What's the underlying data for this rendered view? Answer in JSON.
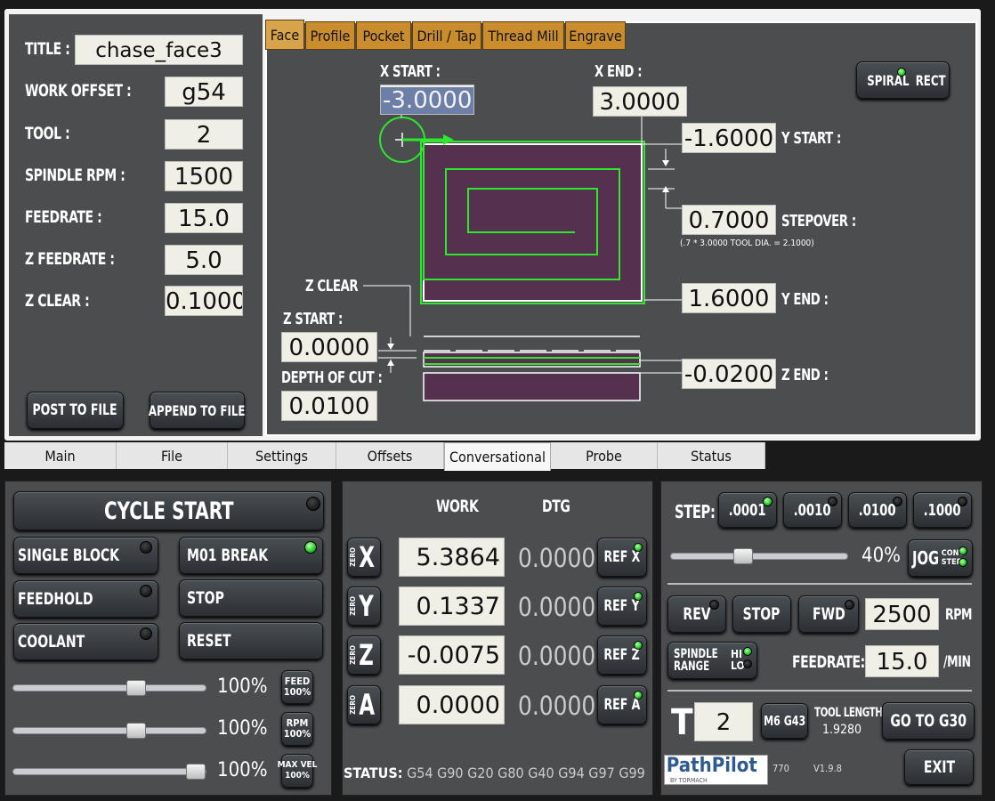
{
  "left_form": {
    "title_label": "TITLE :",
    "title_value": "chase_face3",
    "work_offset_label": "WORK OFFSET :",
    "work_offset_value": "g54",
    "tool_label": "TOOL :",
    "tool_value": "2",
    "spindle_label": "SPINDLE RPM :",
    "spindle_value": "1500",
    "feedrate_label": "FEEDRATE :",
    "feedrate_value": "15.0",
    "zfeed_label": "Z FEEDRATE :",
    "zfeed_value": "5.0",
    "zclear_label": "Z CLEAR :",
    "zclear_value": "0.1000",
    "post_button": "POST TO FILE",
    "append_button": "APPEND TO FILE"
  },
  "feature_tabs": [
    "Face",
    "Profile",
    "Pocket",
    "Drill / Tap",
    "Thread Mill",
    "Engrave"
  ],
  "face": {
    "x_start_label": "X START :",
    "x_start_value": "-3.0000",
    "x_end_label": "X END :",
    "x_end_value": "3.0000",
    "y_start_label": "Y START :",
    "y_start_value": "-1.6000",
    "stepover_label": "STEPOVER :",
    "stepover_value": "0.7000",
    "stepover_note": "(.7 * 3.0000 TOOL DIA. = 2.1000)",
    "y_end_label": "Y END :",
    "y_end_value": "1.6000",
    "z_clear_label": "Z CLEAR",
    "z_start_label": "Z START :",
    "z_start_value": "0.0000",
    "doc_label": "DEPTH OF CUT :",
    "doc_value": "0.0100",
    "z_end_label": "Z END :",
    "z_end_value": "-0.0200",
    "spiral_label": "SPIRAL",
    "rect_label": "RECT"
  },
  "main_tabs": [
    "Main",
    "File",
    "Settings",
    "Offsets",
    "Conversational",
    "Probe",
    "Status"
  ],
  "cycle": {
    "cycle_start": "CYCLE START",
    "single_block": "SINGLE BLOCK",
    "m01_break": "M01 BREAK",
    "feedhold": "FEEDHOLD",
    "stop": "STOP",
    "coolant": "COOLANT",
    "reset": "RESET",
    "feed_pct": "100%",
    "rpm_pct": "100%",
    "maxvel_pct": "100%",
    "feed_btn": [
      "FEED",
      "100%"
    ],
    "rpm_btn": [
      "RPM",
      "100%"
    ],
    "maxvel_btn": [
      "MAX VEL",
      "100%"
    ],
    "feed_override": 1.0,
    "rpm_override": 1.0,
    "maxvel_override": 1.0
  },
  "dro": {
    "work_header": "WORK",
    "dtg_header": "DTG",
    "zero_label": "ZERO",
    "axes": [
      {
        "axis": "X",
        "work": "5.3864",
        "dtg": "0.0000",
        "ref": "REF X"
      },
      {
        "axis": "Y",
        "work": "0.1337",
        "dtg": "0.0000",
        "ref": "REF Y"
      },
      {
        "axis": "Z",
        "work": "-0.0075",
        "dtg": "0.0000",
        "ref": "REF Z"
      },
      {
        "axis": "A",
        "work": "0.0000",
        "dtg": "0.0000",
        "ref": "REF A"
      }
    ],
    "status_label": "STATUS:",
    "status_codes": "G54 G90 G20 G80 G40 G94 G97 G99"
  },
  "jog": {
    "step_label": "STEP:",
    "steps": [
      ".0001",
      ".0010",
      ".0100",
      ".1000"
    ],
    "jog_pct": "40%",
    "jog_fraction": 0.4,
    "jog_button": "JOG",
    "cont_label": "CONT",
    "step_mode_label": "STEP",
    "rev": "REV",
    "stop": "STOP",
    "fwd": "FWD",
    "rpm_value": "2500",
    "rpm_unit": "RPM",
    "spindle_range": [
      "SPINDLE",
      "RANGE"
    ],
    "hi": "HI",
    "lo": "LO",
    "feedrate_label": "FEEDRATE:",
    "feedrate_value": "15.0",
    "feed_unit": "/MIN",
    "t_label": "T",
    "tool_value": "2",
    "m6g43": "M6 G43",
    "tool_length_label": "TOOL LENGTH",
    "tool_length_value": "1.9280",
    "goto_g30": "GO TO G30",
    "brand": "PathPilot",
    "brand_sub": "BY TORMACH",
    "model": "770",
    "version": "V1.9.8",
    "exit": "EXIT"
  },
  "colors": {
    "accent_green": "#2ecc2e",
    "tab_orange": "#c98d2e",
    "screen_bg": "#4b4d4f",
    "toolpath": "#2ee82e",
    "stock": "#55304f"
  }
}
